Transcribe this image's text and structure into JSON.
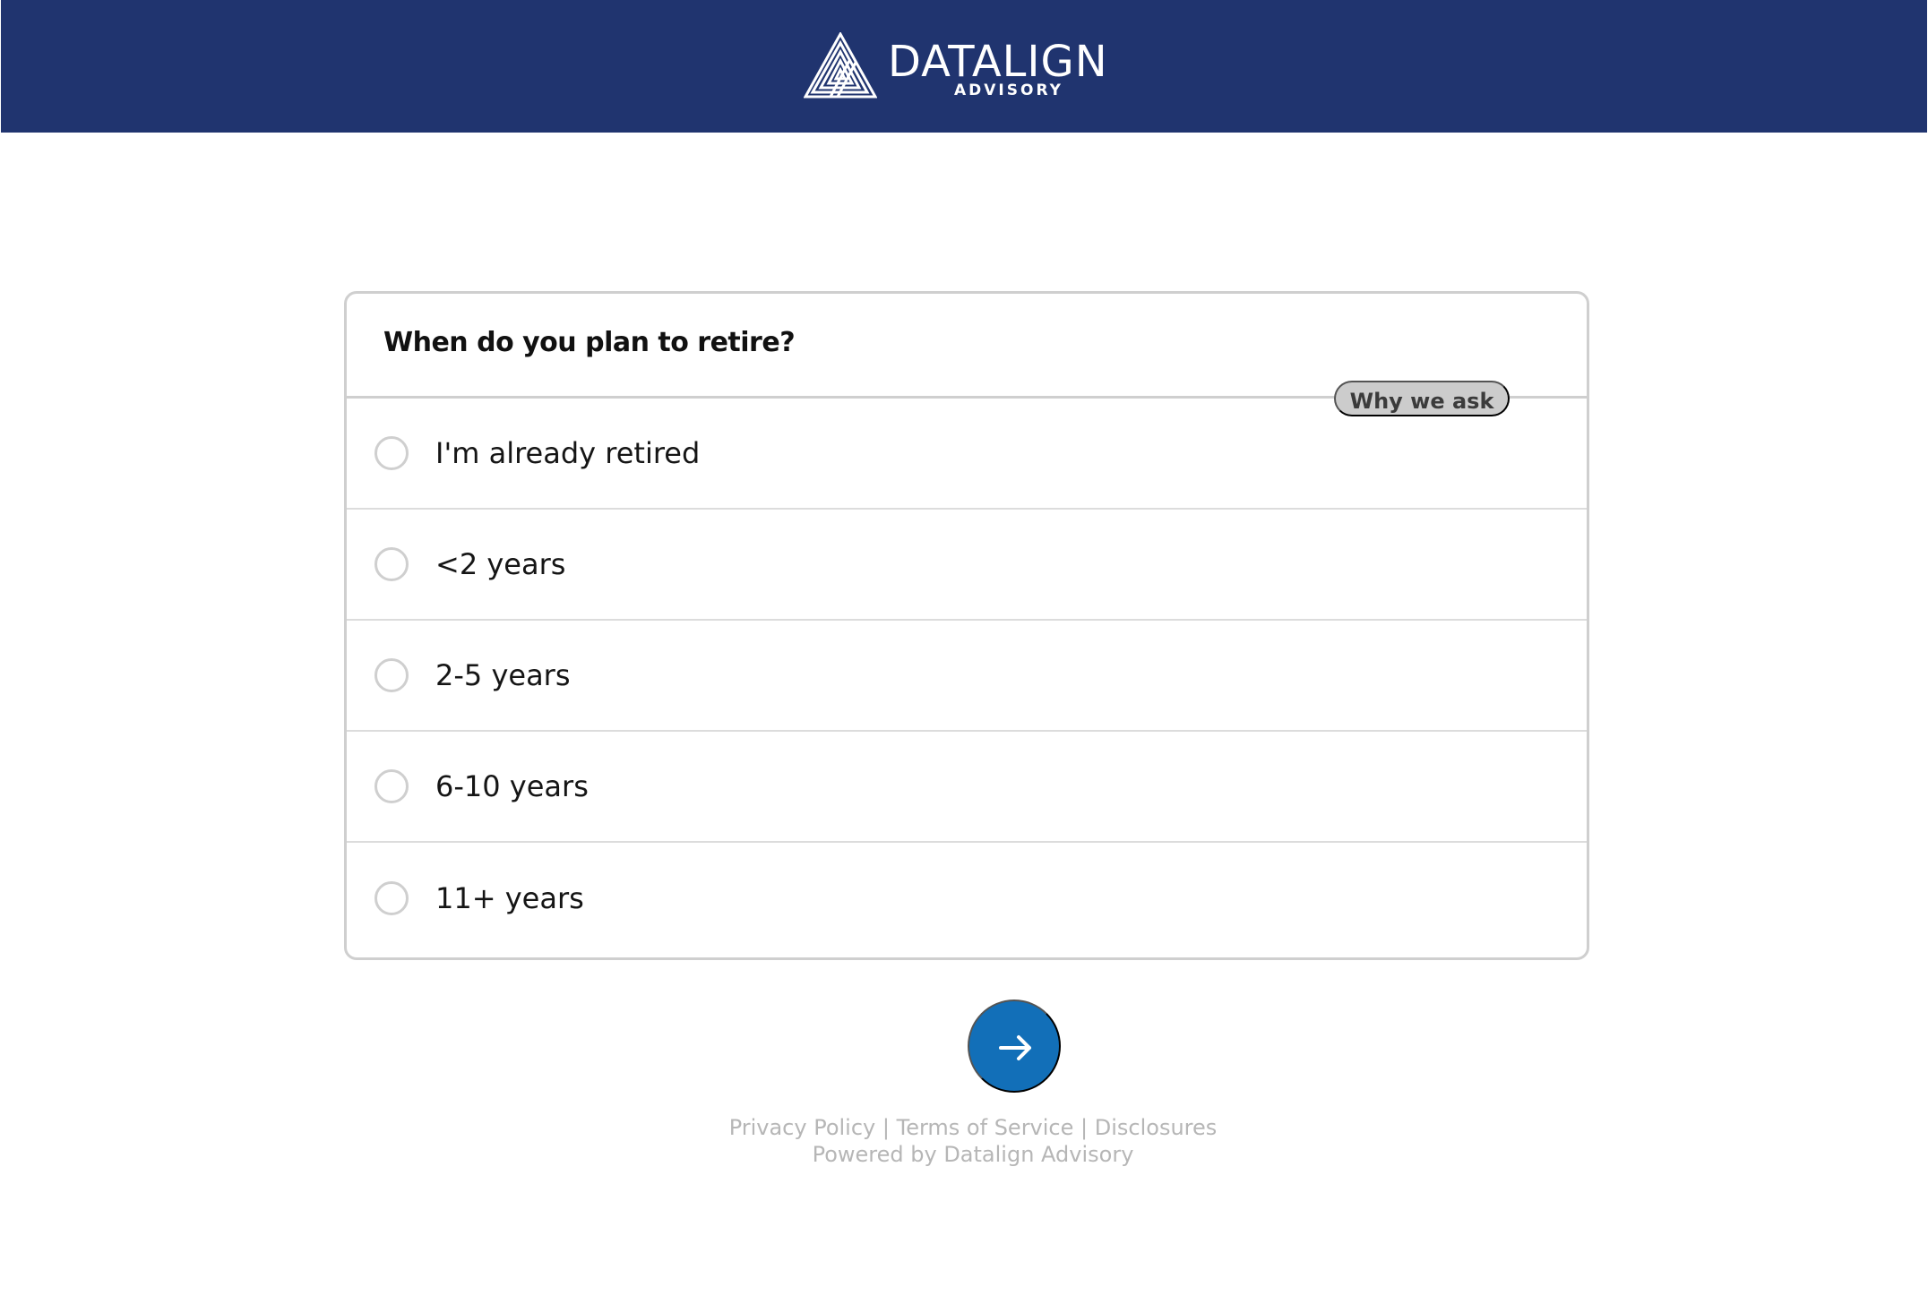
{
  "brand": {
    "name": "DATALIGN",
    "subname": "ADVISORY"
  },
  "question": {
    "title": "When do you plan to retire?",
    "why_label": "Why we ask",
    "options": [
      {
        "label": "I'm already retired",
        "selected": false
      },
      {
        "label": "<2 years",
        "selected": false
      },
      {
        "label": "2-5 years",
        "selected": false
      },
      {
        "label": "6-10 years",
        "selected": false
      },
      {
        "label": "11+ years",
        "selected": false
      }
    ]
  },
  "actions": {
    "next_icon": "arrow-right-icon"
  },
  "footer": {
    "links": [
      {
        "label": "Privacy Policy"
      },
      {
        "label": "Terms of Service"
      },
      {
        "label": "Disclosures"
      }
    ],
    "separator": "|",
    "powered_by": "Powered by Datalign Advisory"
  },
  "colors": {
    "header_bg": "#20346f",
    "button_bg": "#126fb8",
    "border": "#cfcfcf",
    "muted_text": "#b6b6b6"
  }
}
